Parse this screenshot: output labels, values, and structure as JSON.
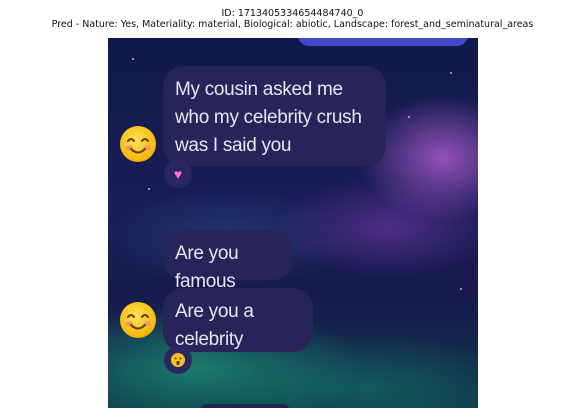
{
  "caption": {
    "id_line": "ID: 1713405334654484740_0",
    "pred_line": "Pred - Nature: Yes, Materiality: material, Biological: abiotic, Landscape: forest_and_seminatural_areas"
  },
  "messages": [
    {
      "text": "My cousin asked me who my celebrity crush was I said you",
      "reaction": "heart"
    },
    {
      "text": "Are you famous"
    },
    {
      "text": "Are you a celebrity",
      "reaction": "hushed-face"
    }
  ],
  "icons": {
    "avatar": "smiling-face-with-blush",
    "reaction_1": "pink-heart",
    "reaction_2": "hushed-face"
  },
  "colors": {
    "bubble": "#262459",
    "bubble_text": "#e8e6f4",
    "top_bubble": "#3f49c9",
    "heart": "#ff6ec2"
  }
}
